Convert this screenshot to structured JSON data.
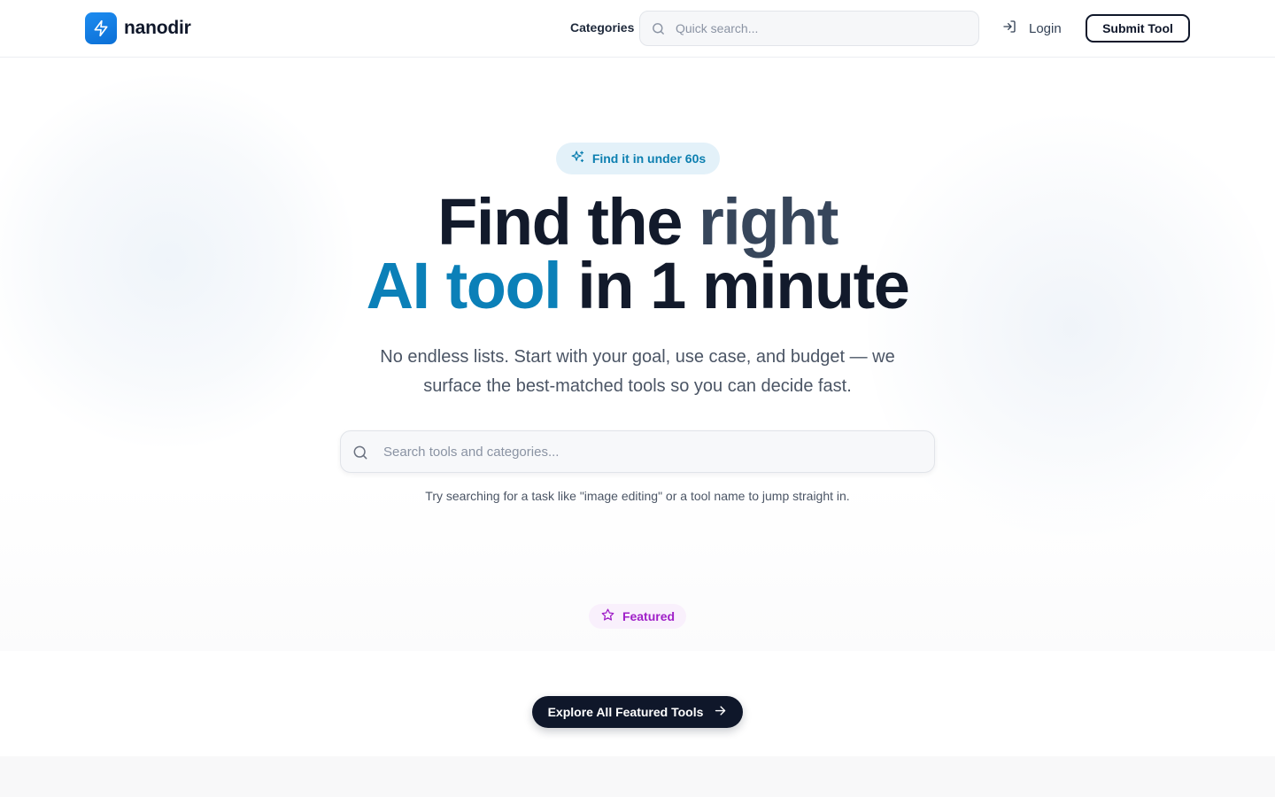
{
  "brand": {
    "name": "nanodir",
    "logo_icon": "lightning-bolt-icon",
    "accent": "#0b6fd6"
  },
  "nav": {
    "categories_label": "Categories",
    "quick_search_placeholder": "Quick search...",
    "login_label": "Login",
    "submit_label": "Submit Tool"
  },
  "hero": {
    "badge_label": "Find it in under 60s",
    "headline_part1": "Find the ",
    "headline_part2": "right",
    "headline_part3": "AI tool",
    "headline_part4": " in 1 minute",
    "subtext": "No endless lists. Start with your goal, use case, and budget — we surface the best-matched tools so you can decide fast.",
    "search_placeholder": "Search tools and categories...",
    "hint": "Try searching for a task like \"image editing\" or a tool name to jump straight in."
  },
  "featured": {
    "badge_label": "Featured",
    "explore_label": "Explore All Featured Tools"
  },
  "colors": {
    "headline_dark": "#121a2b",
    "headline_slate": "#37465b",
    "headline_blue": "#0b80b8",
    "badge_blue_bg": "#e3f1f9",
    "badge_purple": "#a020c8"
  }
}
